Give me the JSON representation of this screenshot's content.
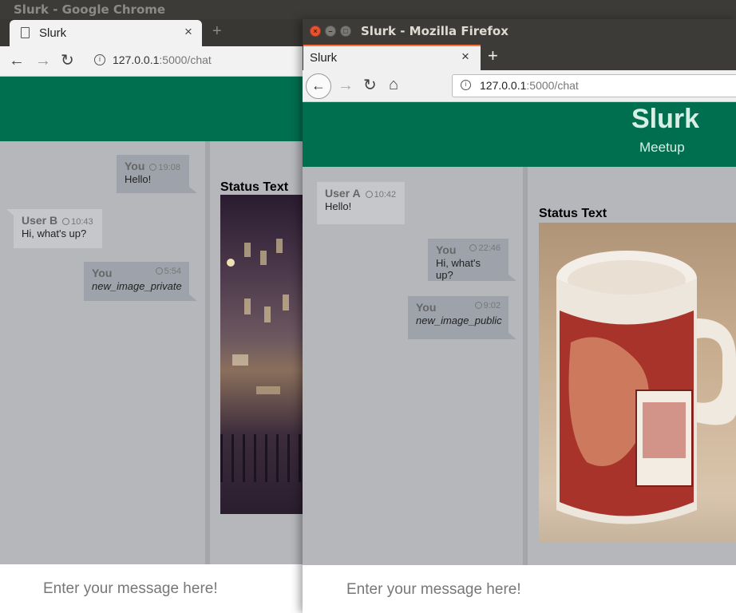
{
  "chrome": {
    "window_title": "Slurk - Google Chrome",
    "tab_title": "Slurk",
    "tab_close": "×",
    "new_tab": "+",
    "url_host": "127.0.0.1",
    "url_path": ":5000/chat",
    "back": "←",
    "forward": "→",
    "reload": "↻",
    "messages": [
      {
        "author": "You",
        "time": "19:08",
        "text": "Hello!"
      },
      {
        "author": "User B",
        "time": "10:43",
        "text": "Hi, what's up?"
      },
      {
        "author": "You",
        "time": "5:54",
        "text": "new_image_private"
      }
    ],
    "status_text": "Status Text",
    "input_placeholder": "Enter your message here!"
  },
  "firefox": {
    "window_title": "Slurk - Mozilla Firefox",
    "close_glyph": "×",
    "min_glyph": "–",
    "max_glyph": "□",
    "tab_title": "Slurk",
    "tab_close": "×",
    "new_tab": "+",
    "url_host": "127.0.0.1",
    "url_path": ":5000/chat",
    "back": "←",
    "forward": "→",
    "reload": "↻",
    "home": "⌂",
    "brand": "Slurk",
    "subtitle": "Meetup",
    "messages": [
      {
        "author": "User A",
        "time": "10:42",
        "text": "Hello!"
      },
      {
        "author": "You",
        "time": "22:46",
        "text": "Hi, what's up?"
      },
      {
        "author": "You",
        "time": "9:02",
        "text": "new_image_public"
      }
    ],
    "status_text": "Status Text",
    "input_placeholder": "Enter your message here!"
  },
  "icons": {
    "info": "i"
  }
}
